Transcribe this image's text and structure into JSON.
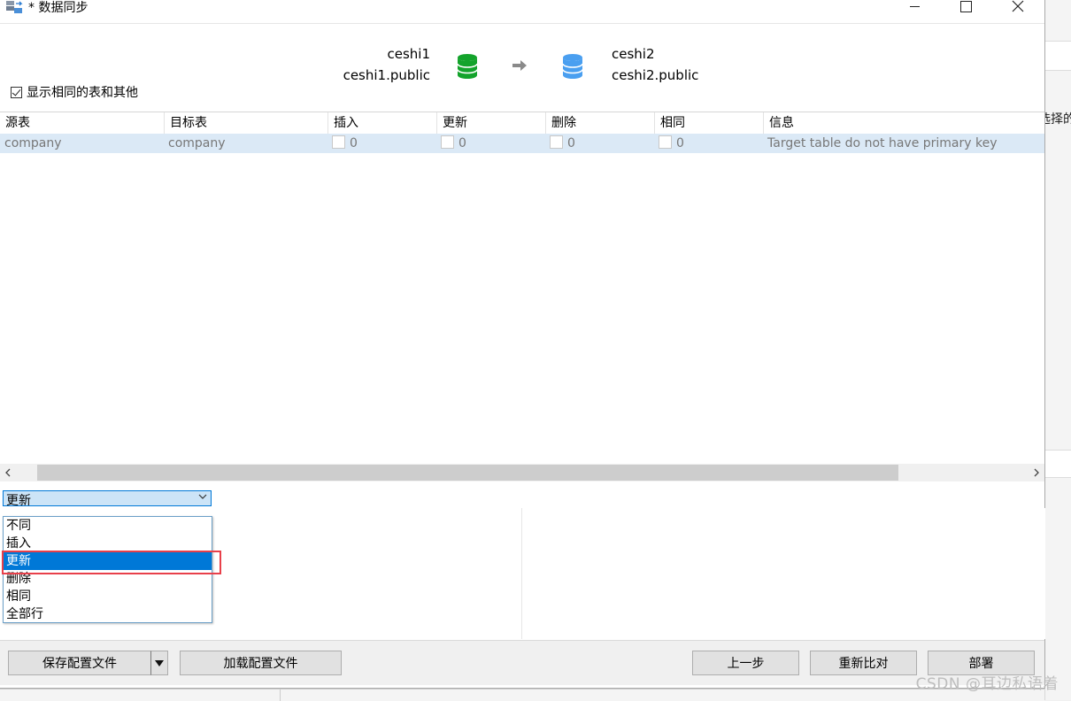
{
  "window": {
    "title": "* 数据同步"
  },
  "header": {
    "source": {
      "connection": "ceshi1",
      "schema": "ceshi1.public"
    },
    "target": {
      "connection": "ceshi2",
      "schema": "ceshi2.public"
    },
    "colors": {
      "source_db": "#13a32b",
      "target_db": "#4a9ff0"
    }
  },
  "options": {
    "show_same_label": "显示相同的表和其他",
    "show_same_checked": true
  },
  "grid": {
    "columns": [
      "源表",
      "目标表",
      "插入",
      "更新",
      "删除",
      "相同",
      "信息"
    ],
    "rows": [
      {
        "source": "company",
        "target": "company",
        "insert": "0",
        "update": "0",
        "delete": "0",
        "same": "0",
        "info": "Target table do not have primary key"
      }
    ]
  },
  "filter": {
    "selected": "更新",
    "options": [
      "不同",
      "插入",
      "更新",
      "删除",
      "相同",
      "全部行"
    ]
  },
  "footer": {
    "save_config": "保存配置文件",
    "load_config": "加载配置文件",
    "prev": "上一步",
    "recompare": "重新比对",
    "deploy": "部署"
  },
  "background": {
    "right_cut_text": "选择的"
  },
  "watermark": "CSDN @耳边私语着"
}
